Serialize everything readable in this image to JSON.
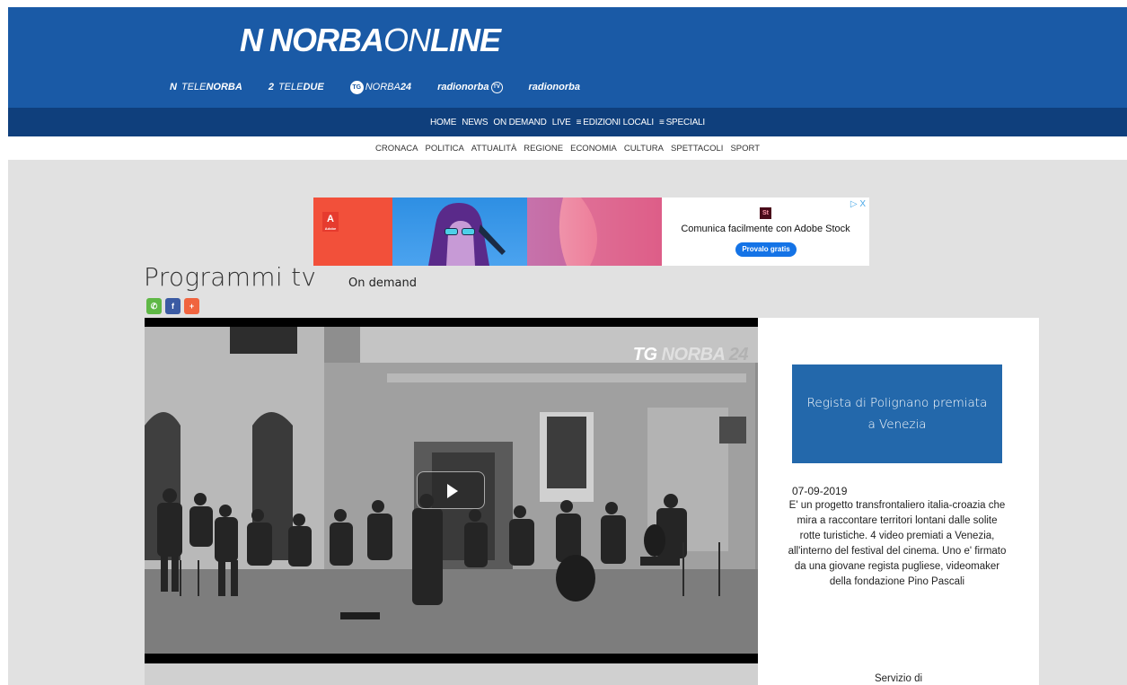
{
  "header": {
    "logo": {
      "mark": "N",
      "part1": "NORBA",
      "part2": "ON",
      "part3": "LINE"
    },
    "channels": [
      {
        "icon": "N",
        "prefix": "TELE",
        "bold": "NORBA"
      },
      {
        "icon": "2",
        "prefix": "TELE",
        "bold": "DUE"
      },
      {
        "icon": "TG",
        "prefix": "NORBA",
        "bold": "24"
      },
      {
        "icon": "",
        "prefix": "radionorba",
        "bold": ""
      },
      {
        "icon": "",
        "prefix": "radionorba",
        "bold": ""
      }
    ]
  },
  "main_nav": {
    "items": [
      "HOME",
      "NEWS",
      "ON DEMAND",
      "LIVE",
      "EDIZIONI LOCALI",
      "SPECIALI"
    ],
    "hamburger": "≡"
  },
  "sub_nav": {
    "items": [
      "CRONACA",
      "POLITICA",
      "ATTUALITÀ",
      "REGIONE",
      "ECONOMIA",
      "CULTURA",
      "SPETTACOLI",
      "SPORT"
    ]
  },
  "ad": {
    "adobe_label": "Adobe",
    "stock_logo": "St",
    "headline": "Comunica facilmente con Adobe Stock",
    "button": "Provalo gratis",
    "close": "▷ X"
  },
  "page": {
    "title": "Programmi tv",
    "subtitle": "On demand"
  },
  "share": {
    "whatsapp": "✆",
    "facebook": "f",
    "more": "+"
  },
  "video": {
    "watermark_tg": "TG",
    "watermark_norba": "NORBA",
    "watermark_24": "24"
  },
  "sidebar": {
    "title": "Regista di Polignano premiata a Venezia",
    "date": "07-09-2019",
    "description": "E' un progetto transfrontaliero italia-croazia che mira a raccontare territori lontani dalle solite rotte turistiche. 4 video premiati a Venezia, all'interno del festival del cinema. Uno e' firmato da una giovane regista pugliese, videomaker della fondazione Pino Pascali",
    "footer": "Servizio di"
  }
}
